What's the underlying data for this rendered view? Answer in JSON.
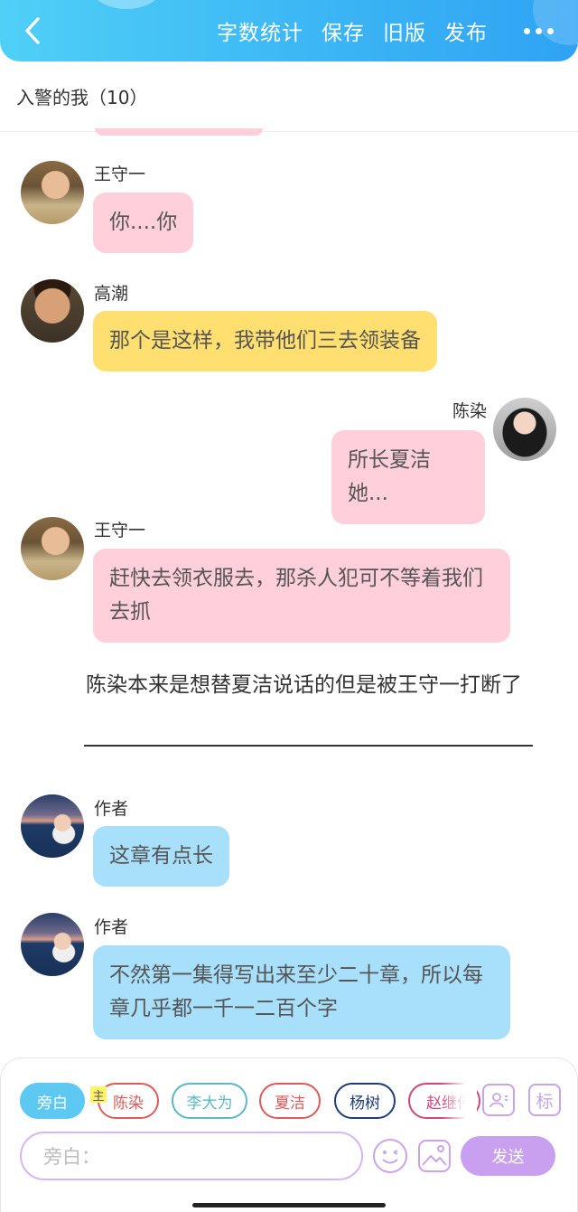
{
  "header": {
    "menu": [
      "字数统计",
      "保存",
      "旧版",
      "发布"
    ],
    "back_icon": "chevron-left-icon",
    "more_icon": "more-dots-icon",
    "colors": {
      "gradient_start": "#4fd0f7",
      "gradient_end": "#2fa3f3"
    }
  },
  "chapter": {
    "title": "入警的我（10）"
  },
  "messages": [
    {
      "speaker": "王守一",
      "text": "你....你",
      "color": "#ffcfdc"
    },
    {
      "speaker": "高潮",
      "text": "那个是这样，我带他们三去领装备",
      "color": "#fedf70"
    },
    {
      "speaker": "陈染",
      "text": "所长夏洁她...",
      "color": "#ffcfdc"
    },
    {
      "speaker": "王守一",
      "text": "赶快去领衣服去，那杀人犯可不等着我们去抓",
      "color": "#ffcfdc"
    }
  ],
  "narration": "陈染本来是想替夏洁说话的但是被王守一打断了",
  "author_messages": [
    {
      "speaker": "作者",
      "text": "这章有点长",
      "color": "#a8dffb"
    },
    {
      "speaker": "作者",
      "text": "不然第一集得写出来至少二十章，所以每章几乎都一千一二百个字",
      "color": "#a8dffb"
    }
  ],
  "composer": {
    "roles": [
      {
        "label": "旁白",
        "color": "#5dc8f2",
        "active": true
      },
      {
        "label": "陈染",
        "color": "#e05a5a",
        "active": false
      },
      {
        "label": "李大为",
        "color": "#5ab9c4",
        "active": false
      },
      {
        "label": "夏洁",
        "color": "#e05a5a",
        "active": false
      },
      {
        "label": "杨树",
        "color": "#1f3c7a",
        "active": false
      },
      {
        "label": "赵继伟",
        "color": "#d1457a",
        "active": false
      }
    ],
    "main_tag": "主",
    "tag_icon_label": "标",
    "input_placeholder": "旁白：",
    "send_label": "发送",
    "icons": [
      "role-manage-icon",
      "tag-icon",
      "emoji-icon",
      "image-icon"
    ]
  }
}
